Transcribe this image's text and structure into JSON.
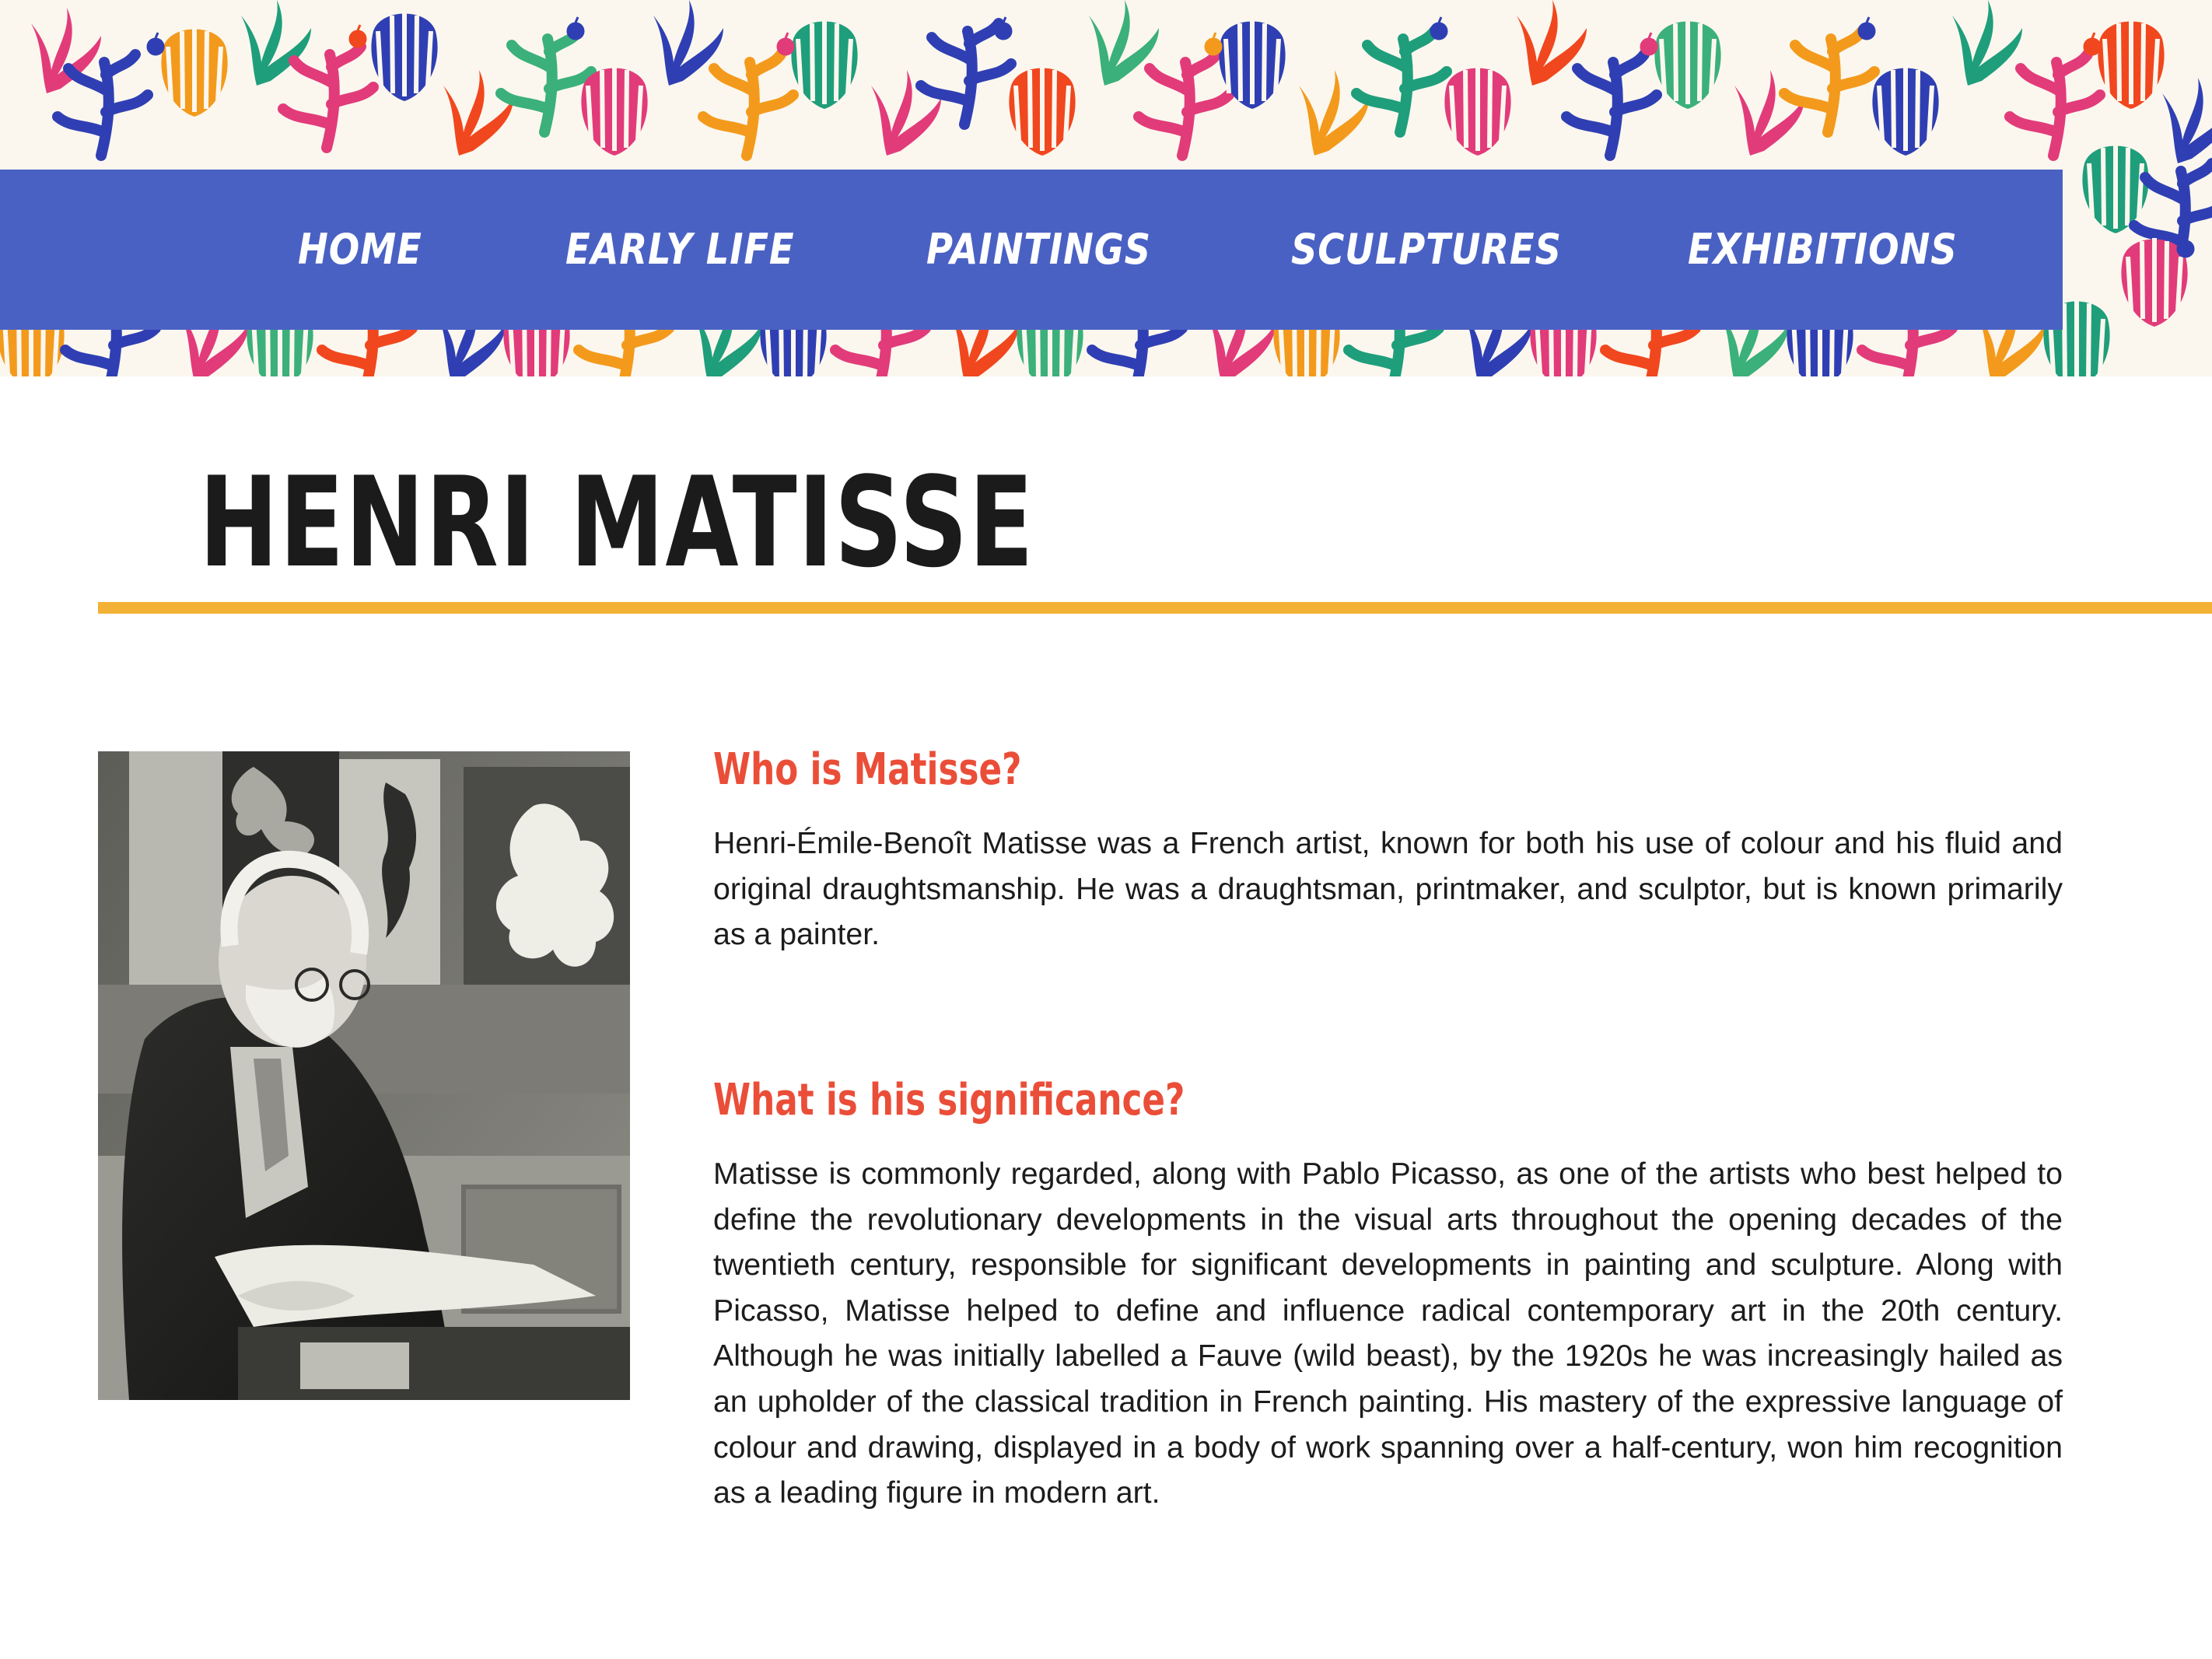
{
  "colors": {
    "nav_background": "#4a61c4",
    "nav_text": "#ffffff",
    "accent_rule": "#f3b235",
    "heading": "#ea4e38",
    "body_text": "#1c1c1c",
    "title": "#1b1b1b"
  },
  "nav": {
    "items": [
      {
        "label": "HOME"
      },
      {
        "label": "EARLY LIFE"
      },
      {
        "label": "PAINTINGS"
      },
      {
        "label": "SCULPTURES"
      },
      {
        "label": "EXHIBITIONS"
      }
    ]
  },
  "page": {
    "title": "HENRI MATISSE"
  },
  "sections": [
    {
      "heading": "Who is Matisse?",
      "body": "Henri-Émile-Benoît Matisse was a French artist, known for both his use of colour and his fluid and original draughtsmanship. He was a draughtsman, printmaker, and sculptor, but is known primarily as a painter."
    },
    {
      "heading": "What is his significance?",
      "body": "Matisse is commonly regarded, along with Pablo Picasso, as one of the artists who best helped to define the revolutionary developments in the visual arts throughout the opening decades of the twentieth century, responsible for significant developments in painting and sculpture. Along with Picasso, Matisse helped to define and influence radical contemporary art in the 20th century. Although he was initially labelled a Fauve (wild beast), by the 1920s he was increasingly hailed as an upholder of the classical tradition in French painting. His mastery of the expressive language of colour and drawing, displayed in a body of work spanning over a half-century, won him recognition as a leading figure in modern art."
    }
  ]
}
